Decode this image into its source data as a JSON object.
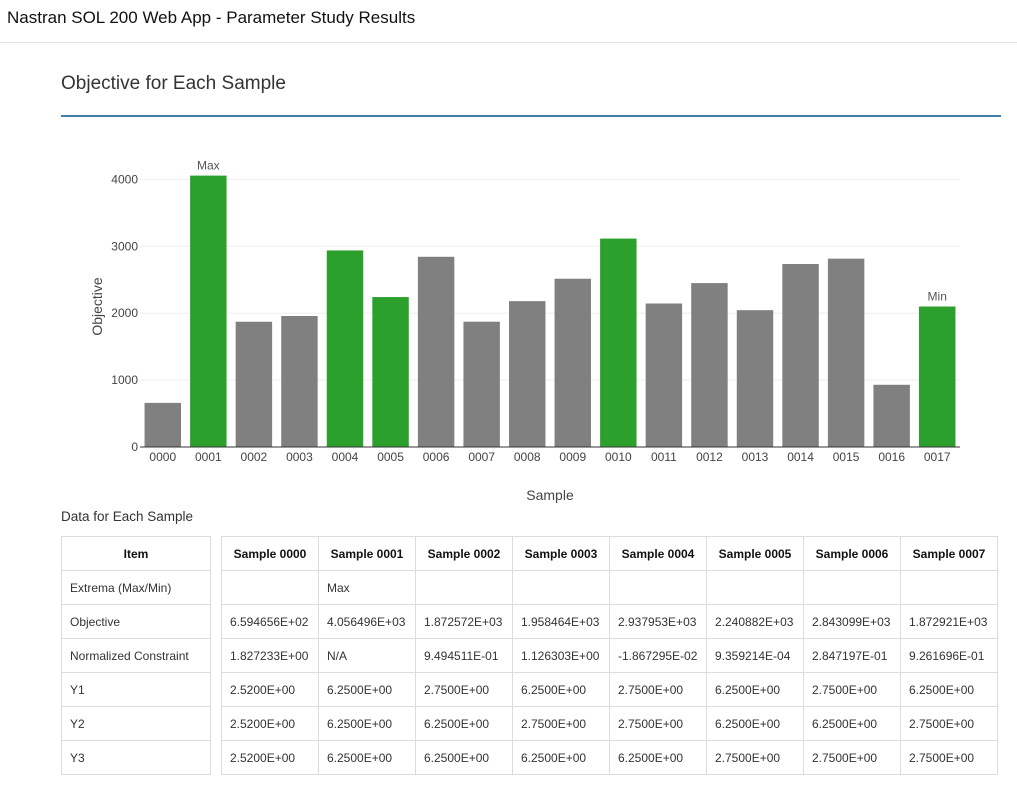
{
  "app": {
    "title": "Nastran SOL 200 Web App - Parameter Study Results"
  },
  "section": {
    "title": "Objective for Each Sample"
  },
  "chart_data": {
    "type": "bar",
    "title": "",
    "xlabel": "Sample",
    "ylabel": "Objective",
    "ylim": [
      0,
      4200
    ],
    "yticks": [
      0,
      1000,
      2000,
      3000,
      4000
    ],
    "grid": true,
    "legend": "none",
    "categories": [
      "0000",
      "0001",
      "0002",
      "0003",
      "0004",
      "0005",
      "0006",
      "0007",
      "0008",
      "0009",
      "0010",
      "0011",
      "0012",
      "0013",
      "0014",
      "0015",
      "0016",
      "0017"
    ],
    "values": [
      659.4656,
      4056.496,
      1872.572,
      1958.464,
      2937.953,
      2240.882,
      2843.099,
      1872.921,
      2180,
      2515,
      3115,
      2145,
      2450,
      2045,
      2735,
      2815,
      930,
      2100
    ],
    "highlighted": [
      false,
      true,
      false,
      false,
      true,
      true,
      false,
      false,
      false,
      false,
      true,
      false,
      false,
      false,
      false,
      false,
      false,
      true
    ],
    "annotations": [
      {
        "category": "0001",
        "text": "Max"
      },
      {
        "category": "0017",
        "text": "Min"
      }
    ],
    "colors": {
      "default": "#808080",
      "highlight": "#2ca02c"
    }
  },
  "table": {
    "caption": "Data for Each Sample",
    "item_header": "Item",
    "row_labels": [
      "Extrema (Max/Min)",
      "Objective",
      "Normalized Constraint",
      "Y1",
      "Y2",
      "Y3"
    ],
    "columns": [
      {
        "header": "Sample 0000",
        "cells": [
          "",
          "6.594656E+02",
          "1.827233E+00",
          "2.5200E+00",
          "2.5200E+00",
          "2.5200E+00"
        ]
      },
      {
        "header": "Sample 0001",
        "cells": [
          "Max",
          "4.056496E+03",
          "N/A",
          "6.2500E+00",
          "6.2500E+00",
          "6.2500E+00"
        ]
      },
      {
        "header": "Sample 0002",
        "cells": [
          "",
          "1.872572E+03",
          "9.494511E-01",
          "2.7500E+00",
          "6.2500E+00",
          "6.2500E+00"
        ]
      },
      {
        "header": "Sample 0003",
        "cells": [
          "",
          "1.958464E+03",
          "1.126303E+00",
          "6.2500E+00",
          "2.7500E+00",
          "6.2500E+00"
        ]
      },
      {
        "header": "Sample 0004",
        "cells": [
          "",
          "2.937953E+03",
          "-1.867295E-02",
          "2.7500E+00",
          "2.7500E+00",
          "6.2500E+00"
        ]
      },
      {
        "header": "Sample 0005",
        "cells": [
          "",
          "2.240882E+03",
          "9.359214E-04",
          "6.2500E+00",
          "6.2500E+00",
          "2.7500E+00"
        ]
      },
      {
        "header": "Sample 0006",
        "cells": [
          "",
          "2.843099E+03",
          "2.847197E-01",
          "2.7500E+00",
          "6.2500E+00",
          "2.7500E+00"
        ]
      },
      {
        "header": "Sample 0007",
        "cells": [
          "",
          "1.872921E+03",
          "9.261696E-01",
          "6.2500E+00",
          "2.7500E+00",
          "2.7500E+00"
        ]
      }
    ]
  }
}
